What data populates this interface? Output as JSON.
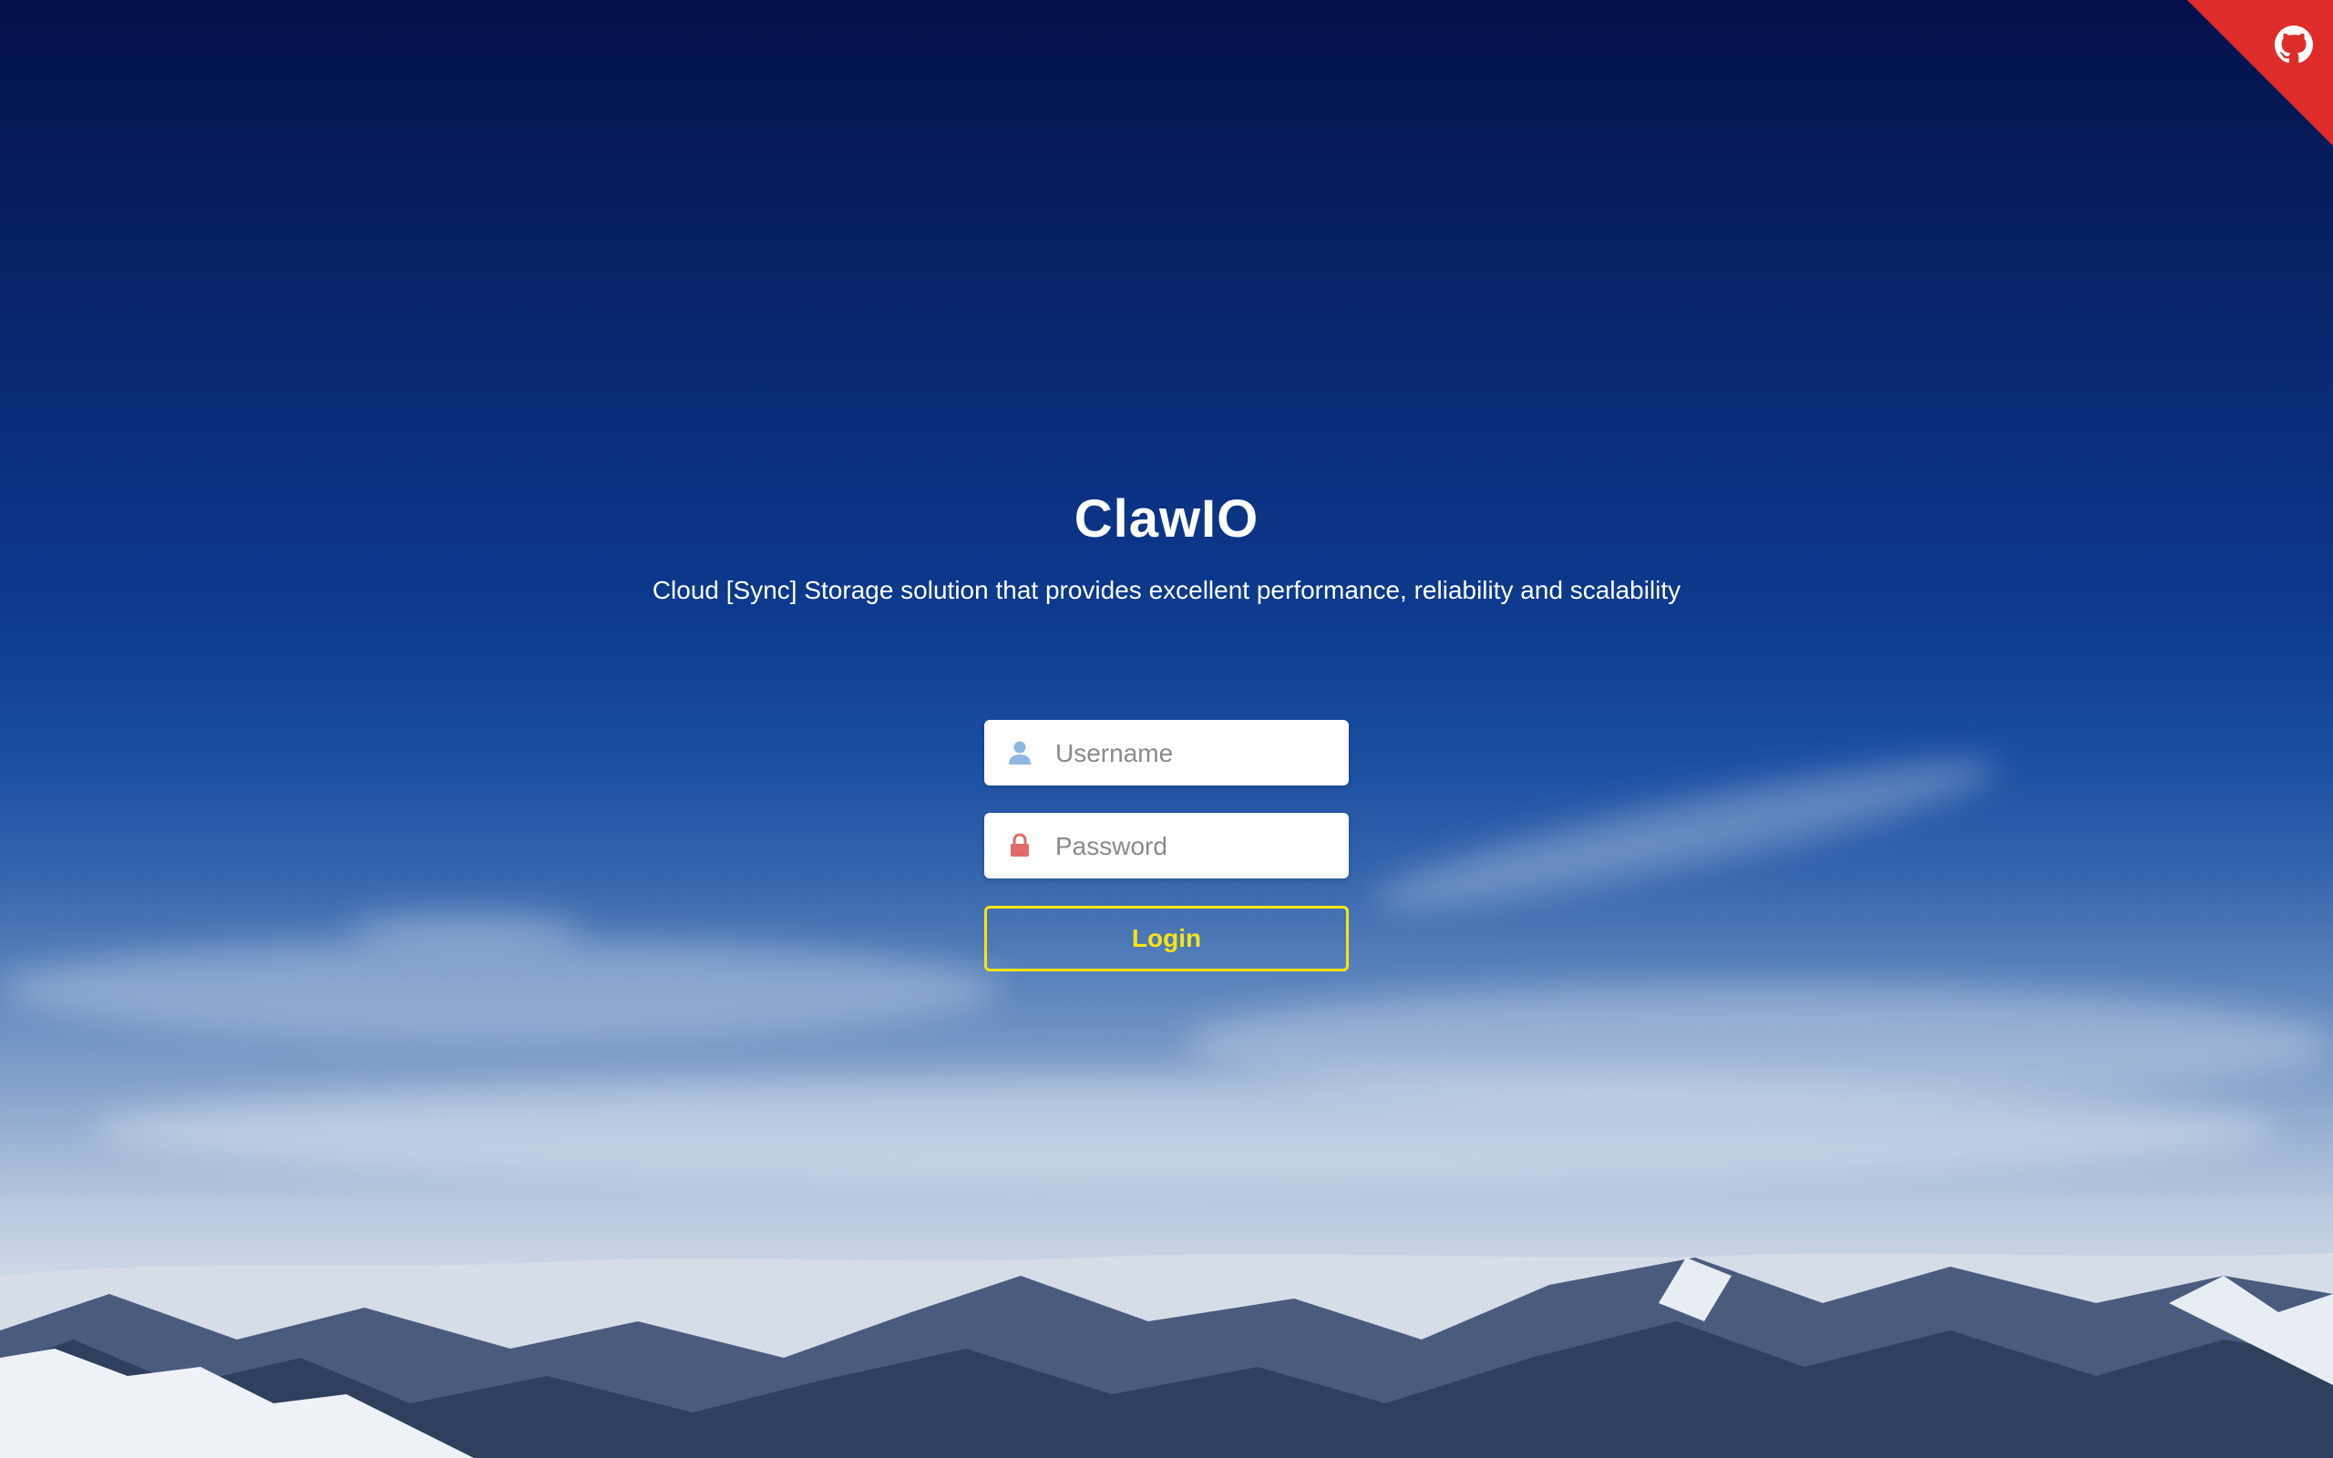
{
  "header": {
    "title": "ClawIO",
    "subtitle": "Cloud [Sync] Storage solution that provides excellent performance, reliability and scalability"
  },
  "login_form": {
    "username_placeholder": "Username",
    "username_value": "",
    "password_placeholder": "Password",
    "password_value": "",
    "login_label": "Login"
  },
  "corner_ribbon": {
    "icon": "github-icon",
    "color": "#e02b2b"
  },
  "colors": {
    "accent_button": "#f5e416",
    "user_icon": "#8fb8e0",
    "lock_icon": "#e06a6a",
    "text": "#ffffff"
  }
}
